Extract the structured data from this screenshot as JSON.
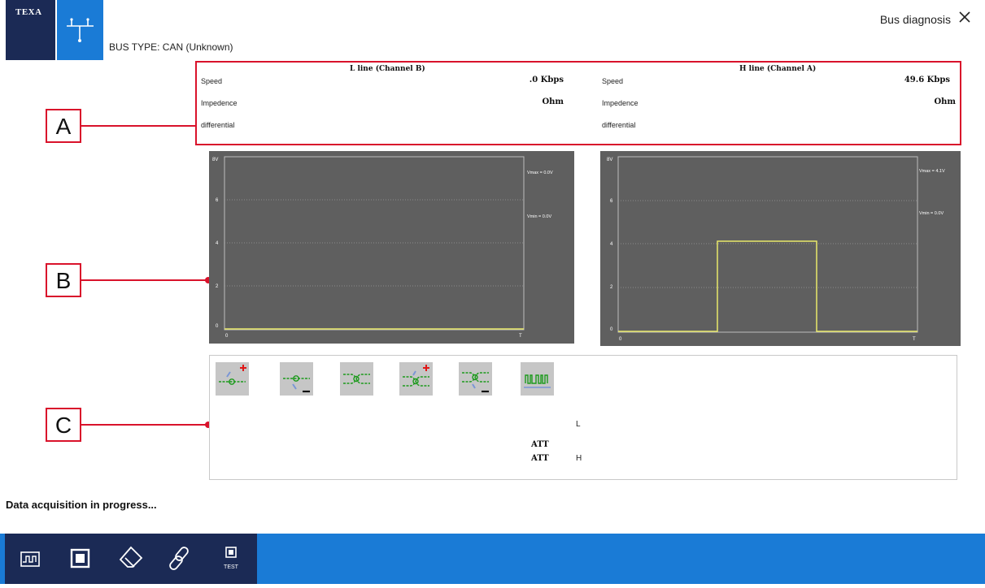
{
  "header": {
    "logo_text": "TEXA",
    "bus_type": "BUS TYPE: CAN (Unknown)",
    "title": "Bus diagnosis",
    "close_icon": "close-icon"
  },
  "panel_a": {
    "l_line": {
      "title": "L line (Channel B)",
      "speed_label": "Speed",
      "speed_value": ".0 Kbps",
      "impedence_label": "Impedence",
      "impedence_value": "Ohm",
      "differential_label": "differential"
    },
    "h_line": {
      "title": "H line (Channel A)",
      "speed_label": "Speed",
      "speed_value": "49.6 Kbps",
      "impedence_label": "Impedence",
      "impedence_value": "Ohm",
      "differential_label": "differential"
    }
  },
  "callouts": {
    "a": "A",
    "b": "B",
    "c": "C"
  },
  "scopes": {
    "left": {
      "y_ticks": [
        "8V",
        "6",
        "4",
        "2",
        "0"
      ],
      "x_start": "0",
      "x_end": "T",
      "vmax": "Vmax = 0.0V",
      "vmin": "Vmin = 0.0V",
      "trace_color": "#e8e86a"
    },
    "right": {
      "y_ticks": [
        "8V",
        "6",
        "4",
        "2",
        "0"
      ],
      "x_start": "0",
      "x_end": "T",
      "vmax": "Vmax = 4.1V",
      "vmin": "Vmin = 0.0V",
      "trace_color": "#e8e86a"
    }
  },
  "panel_c": {
    "tools": [
      "add-termination-icon",
      "remove-termination-icon",
      "connect-lines-icon",
      "add-line-connection-icon",
      "remove-line-connection-icon",
      "signal-waveform-icon"
    ],
    "l_label": "L",
    "h_label": "H",
    "att1": "ATT",
    "att2": "ATT"
  },
  "status": "Data acquisition in progress...",
  "toolbar": {
    "items": [
      {
        "icon": "waveform-icon"
      },
      {
        "icon": "stop-icon"
      },
      {
        "icon": "eraser-icon"
      },
      {
        "icon": "link-icon"
      },
      {
        "icon": "test-icon",
        "label": "TEST"
      }
    ]
  },
  "colors": {
    "brand_dark": "#1b2a55",
    "brand_blue": "#1a7bd6",
    "callout_red": "#d9122b",
    "scope_bg": "#5f5f5f"
  }
}
